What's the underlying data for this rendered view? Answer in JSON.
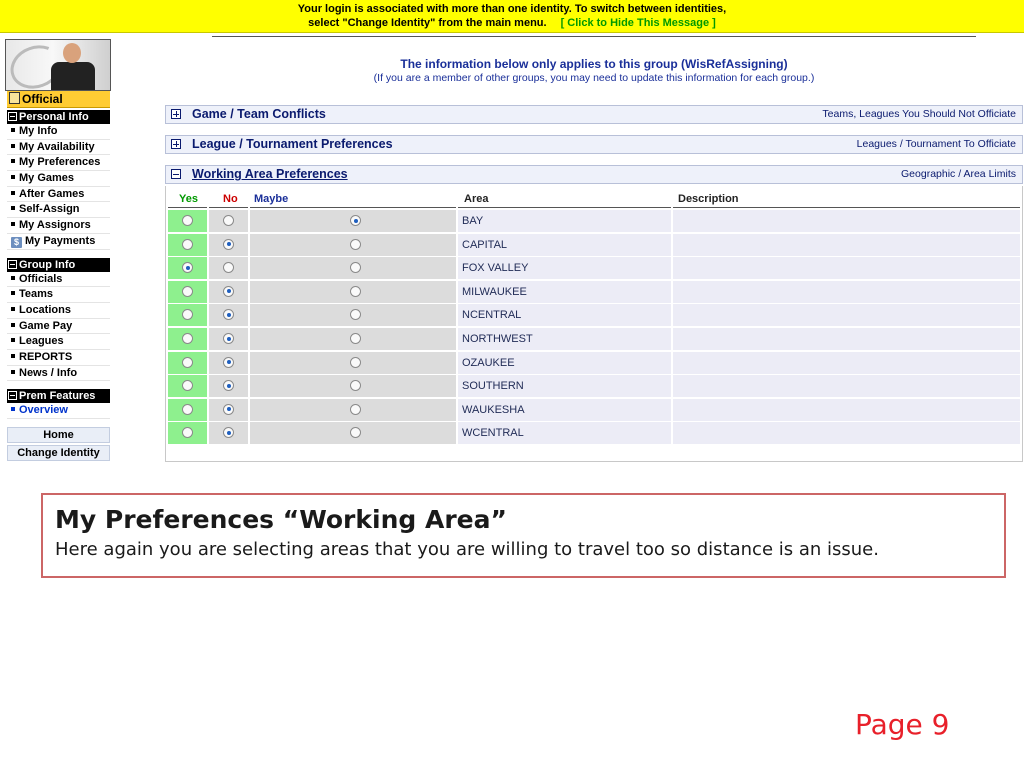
{
  "banner": {
    "line1": "Your login is associated with more than one identity. To switch between identities,",
    "line2": "select \"Change Identity\" from the main menu.",
    "hide_link": "[ Click to Hide This Message ]"
  },
  "sidebar": {
    "official": "Official",
    "personal_header": "Personal Info",
    "personal_items": [
      "My Info",
      "My Availability",
      "My Preferences",
      "My Games",
      "After Games",
      "Self-Assign",
      "My Assignors",
      "My Payments"
    ],
    "group_header": "Group Info",
    "group_items": [
      "Officials",
      "Teams",
      "Locations",
      "Game Pay",
      "Leagues",
      "REPORTS",
      "News / Info"
    ],
    "prem_header": "Prem Features",
    "prem_items": [
      "Overview"
    ],
    "home_button": "Home",
    "change_identity_button": "Change Identity"
  },
  "info": {
    "line1": "The information below only applies to this group (WisRefAssigning)",
    "line2": "(If you are a member of other groups, you may need to update this information for each group.)"
  },
  "sections": [
    {
      "title": "Game / Team Conflicts",
      "right": "Teams, Leagues You Should Not Officiate"
    },
    {
      "title": "League / Tournament Preferences",
      "right": "Leagues / Tournament To Officiate"
    },
    {
      "title": "Working Area Preferences",
      "right": "Geographic / Area Limits"
    }
  ],
  "table": {
    "headers": {
      "yes": "Yes",
      "no": "No",
      "maybe": "Maybe",
      "area": "Area",
      "description": "Description"
    },
    "rows": [
      {
        "area": "BAY",
        "selected": "maybe",
        "description": ""
      },
      {
        "area": "CAPITAL",
        "selected": "no",
        "description": ""
      },
      {
        "area": "FOX VALLEY",
        "selected": "yes",
        "description": ""
      },
      {
        "area": "MILWAUKEE",
        "selected": "no",
        "description": ""
      },
      {
        "area": "NCENTRAL",
        "selected": "no",
        "description": ""
      },
      {
        "area": "NORTHWEST",
        "selected": "no",
        "description": ""
      },
      {
        "area": "OZAUKEE",
        "selected": "no",
        "description": ""
      },
      {
        "area": "SOUTHERN",
        "selected": "no",
        "description": ""
      },
      {
        "area": "WAUKESHA",
        "selected": "no",
        "description": ""
      },
      {
        "area": "WCENTRAL",
        "selected": "no",
        "description": ""
      }
    ]
  },
  "caption": {
    "heading": "My Preferences “Working Area”",
    "text": "Here again you are selecting areas that you are willing to travel too so distance is an issue."
  },
  "page_label": "Page 9",
  "colors": {
    "banner": "#ffff00",
    "yes_cell": "#8ef08e",
    "caption_border": "#cc6666",
    "page_label": "#e8202a"
  }
}
